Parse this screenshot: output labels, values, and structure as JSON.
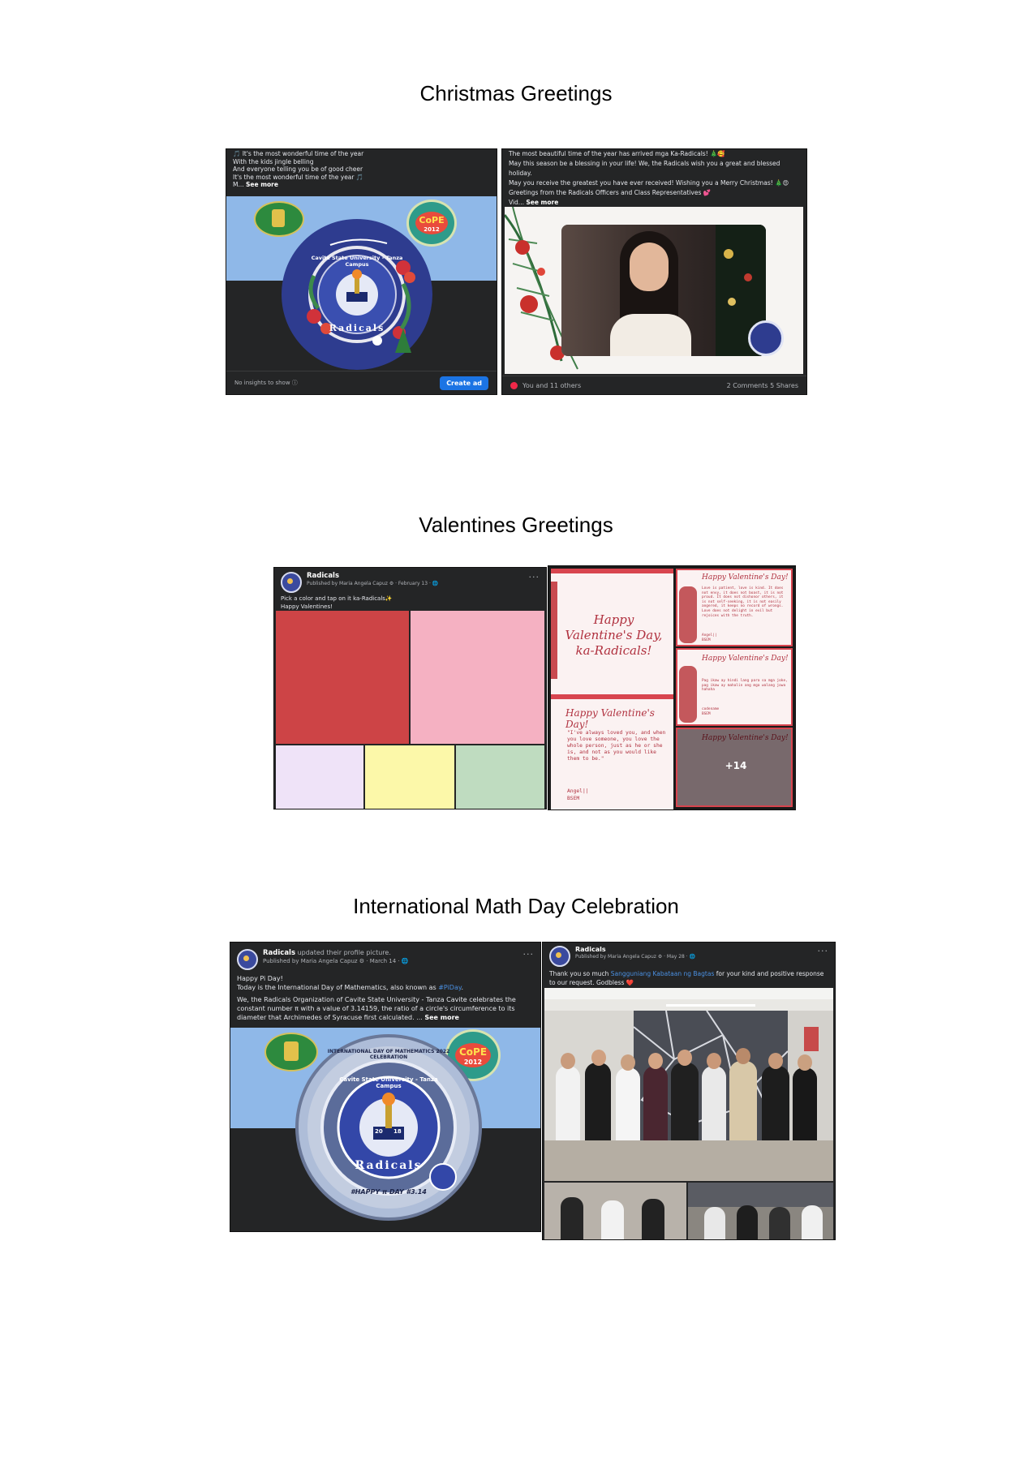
{
  "sections": {
    "christmas": "Christmas Greetings",
    "valentines": "Valentines Greetings",
    "mathday": "International Math Day Celebration"
  },
  "christmas_post1": {
    "lines": [
      "🎵 It's the most wonderful time of the year",
      "With the kids jingle belling",
      "And everyone telling you be of good cheer",
      "It's the most wonderful time of the year 🎵"
    ],
    "more_prefix": "M...",
    "see_more": "See more",
    "insights": "No insights to show ⓘ",
    "ad_button": "Create ad",
    "cope_badge": "CoPE",
    "cope_year": "2012",
    "ring_text": "Cavite State University - Tanza Campus",
    "ring_bottom": "Radicals"
  },
  "christmas_post2": {
    "lines": [
      "The most beautiful time of the year has arrived mga Ka-Radicals! 🎄🥰",
      "May this season be a blessing in your life! We, the Radicals wish you a great and blessed holiday.",
      "May you receive the greatest you have ever received! Wishing you a Merry Christmas! 🎄😍",
      "Greetings from the Radicals Officers and Class Representatives 💕"
    ],
    "more_prefix": "Vid...",
    "see_more": "See more",
    "reactions": "You and 11 others",
    "stats": "2 Comments  5 Shares"
  },
  "valentine_post1": {
    "name": "Radicals",
    "sub": "Published by Maria Angela Capuz ⚙ · February 13 · 🌐",
    "caption1": "Pick a color and tap on it ka-Radicals✨",
    "caption2": "Happy Valentines!",
    "colors": [
      "#cd4446",
      "#f5b1c2",
      "#efe3f8",
      "#fcf8a9",
      "#bfdcc0"
    ]
  },
  "valentine_post2": {
    "big_title": "Happy Valentine's Day, ka-Radicals!",
    "card_title": "Happy Valentine's Day!",
    "quote": "\"I've always loved you, and when you love someone, you love the whole person, just as he or she is, and not as you would like them to be.\"",
    "quote_by": "Angel||",
    "quote_dept": "BSEM",
    "card2_text": "Love is patient, love is kind. It does not envy, it does not boast, it is not proud. It does not dishonor others, it is not self-seeking, it is not easily angered, it keeps no record of wrongs. Love does not delight in evil but rejoices with the truth.",
    "card2_by": "Angel||",
    "card2_dept": "BSEM",
    "card3_text": "Pag ikaw ay hindi lang para sa mga joke, pag ikaw ay mahalin ang mga walang jowa hahaha",
    "card3_by": "codename",
    "card3_dept": "BSEM",
    "more_count": "+14"
  },
  "math_post1": {
    "name": "Radicals",
    "action": "updated their profile picture.",
    "sub": "Published by Maria Angela Capuz ⚙ · March 14 · 🌐",
    "line1": "Happy Pi Day!",
    "line2_prefix": "Today is the International Day of Mathematics, also known as ",
    "hashtag": "#PiDay",
    "line2_suffix": ".",
    "line3": "We, the Radicals Organization of Cavite State University - Tanza Cavite celebrates the constant number π with a value of 3.14159, the ratio of a circle's circumference to its diameter that Archimedes of Syracuse first calculated. ...",
    "see_more": "See more",
    "ring_outer": "INTERNATIONAL DAY OF MATHEMATICS 2022 CELEBRATION",
    "ring_inner": "Cavite State University - Tanza Campus",
    "ring_bottom": "Radicals",
    "pi_day": "#HAPPY π DAY  #3.14",
    "year_left": "20",
    "year_right": "18",
    "cope_badge": "CoPE",
    "cope_year": "2012"
  },
  "math_post2": {
    "name": "Radicals",
    "sub": "Published by Maria Angela Capuz ⚙ · May 28 · 🌐",
    "caption_prefix": "Thank you so much ",
    "link": "Sangguniang Kabataan ng Bagtas",
    "caption_suffix": " for your kind and positive response to our request. Godbless ❤️"
  }
}
